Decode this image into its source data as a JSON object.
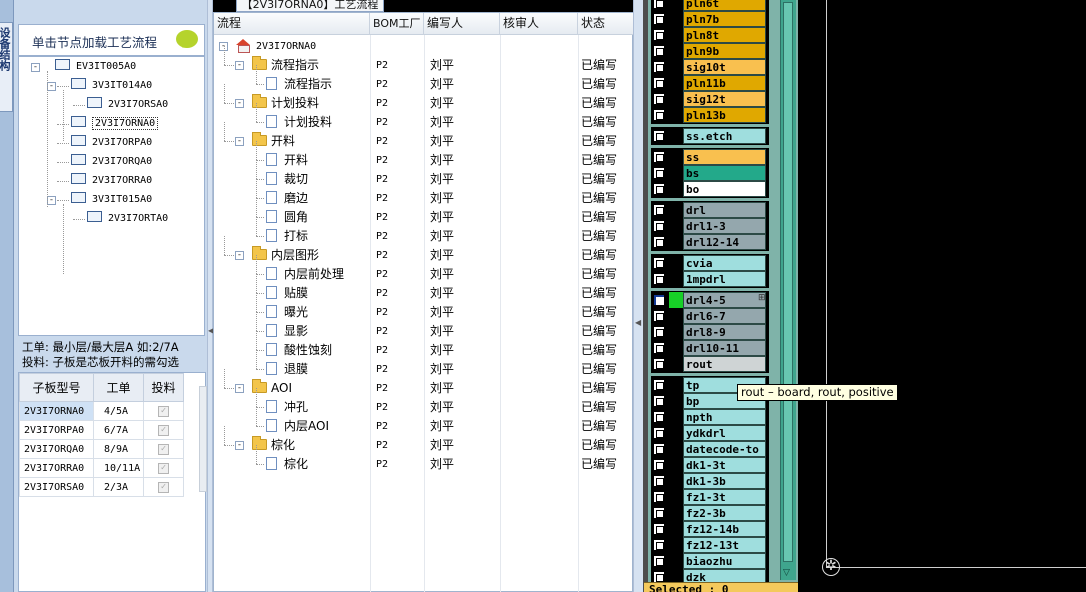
{
  "window_title_tab": "【2V3I7ORNA0】工艺流程",
  "left": {
    "side_tab": "设备结构",
    "hint": "单击节点加载工艺流程",
    "tree": [
      {
        "label": "EV3IT005A0",
        "level": 0,
        "expand": "-"
      },
      {
        "label": "3V3IT014A0",
        "level": 1,
        "expand": "-"
      },
      {
        "label": "2V3I7ORSA0",
        "level": 2
      },
      {
        "label": "2V3I7ORNA0",
        "level": 1,
        "selected": true
      },
      {
        "label": "2V3I7ORPA0",
        "level": 1
      },
      {
        "label": "2V3I7ORQA0",
        "level": 1
      },
      {
        "label": "2V3I7ORRA0",
        "level": 1
      },
      {
        "label": "3V3IT015A0",
        "level": 1,
        "expand": "-"
      },
      {
        "label": "2V3I7ORTA0",
        "level": 2
      }
    ],
    "info_line1": "工单: 最小层/最大层A 如:2/7A",
    "info_line2": "投料: 子板是芯板开料的需勾选",
    "grid_headers": [
      "子板型号",
      "工单",
      "投料"
    ],
    "grid_rows": [
      {
        "model": "2V3I7ORNA0",
        "order": "4/5A",
        "selected": true
      },
      {
        "model": "2V3I7ORPA0",
        "order": "6/7A"
      },
      {
        "model": "2V3I7ORQA0",
        "order": "8/9A"
      },
      {
        "model": "2V3I7ORRA0",
        "order": "10/11A"
      },
      {
        "model": "2V3I7ORSA0",
        "order": "2/3A"
      }
    ]
  },
  "main": {
    "headers": [
      "流程",
      "BOM工厂",
      "编写人",
      "核审人",
      "状态"
    ],
    "rows": [
      {
        "name": "2V3I7ORNA0",
        "type": "root",
        "level": 0,
        "bom": "",
        "writer": "",
        "status": ""
      },
      {
        "name": "流程指示",
        "type": "folder",
        "level": 1,
        "bom": "P2",
        "writer": "刘平",
        "status": "已编写"
      },
      {
        "name": "流程指示",
        "type": "doc",
        "level": 2,
        "bom": "P2",
        "writer": "刘平",
        "status": "已编写"
      },
      {
        "name": "计划投料",
        "type": "folder",
        "level": 1,
        "bom": "P2",
        "writer": "刘平",
        "status": "已编写"
      },
      {
        "name": "计划投料",
        "type": "doc",
        "level": 2,
        "bom": "P2",
        "writer": "刘平",
        "status": "已编写"
      },
      {
        "name": "开料",
        "type": "folder",
        "level": 1,
        "bom": "P2",
        "writer": "刘平",
        "status": "已编写"
      },
      {
        "name": "开料",
        "type": "doc",
        "level": 2,
        "bom": "P2",
        "writer": "刘平",
        "status": "已编写"
      },
      {
        "name": "裁切",
        "type": "doc",
        "level": 2,
        "bom": "P2",
        "writer": "刘平",
        "status": "已编写"
      },
      {
        "name": "磨边",
        "type": "doc",
        "level": 2,
        "bom": "P2",
        "writer": "刘平",
        "status": "已编写"
      },
      {
        "name": "圆角",
        "type": "doc",
        "level": 2,
        "bom": "P2",
        "writer": "刘平",
        "status": "已编写"
      },
      {
        "name": "打标",
        "type": "doc",
        "level": 2,
        "bom": "P2",
        "writer": "刘平",
        "status": "已编写"
      },
      {
        "name": "内层图形",
        "type": "folder",
        "level": 1,
        "bom": "P2",
        "writer": "刘平",
        "status": "已编写"
      },
      {
        "name": "内层前处理",
        "type": "doc",
        "level": 2,
        "bom": "P2",
        "writer": "刘平",
        "status": "已编写"
      },
      {
        "name": "贴膜",
        "type": "doc",
        "level": 2,
        "bom": "P2",
        "writer": "刘平",
        "status": "已编写"
      },
      {
        "name": "曝光",
        "type": "doc",
        "level": 2,
        "bom": "P2",
        "writer": "刘平",
        "status": "已编写"
      },
      {
        "name": "显影",
        "type": "doc",
        "level": 2,
        "bom": "P2",
        "writer": "刘平",
        "status": "已编写"
      },
      {
        "name": "酸性蚀刻",
        "type": "doc",
        "level": 2,
        "bom": "P2",
        "writer": "刘平",
        "status": "已编写"
      },
      {
        "name": "退膜",
        "type": "doc",
        "level": 2,
        "bom": "P2",
        "writer": "刘平",
        "status": "已编写"
      },
      {
        "name": "AOI",
        "type": "folder",
        "level": 1,
        "bom": "P2",
        "writer": "刘平",
        "status": "已编写"
      },
      {
        "name": "冲孔",
        "type": "doc",
        "level": 2,
        "bom": "P2",
        "writer": "刘平",
        "status": "已编写"
      },
      {
        "name": "内层AOI",
        "type": "doc",
        "level": 2,
        "bom": "P2",
        "writer": "刘平",
        "status": "已编写"
      },
      {
        "name": "棕化",
        "type": "folder",
        "level": 1,
        "bom": "P2",
        "writer": "刘平",
        "status": "已编写"
      },
      {
        "name": "棕化",
        "type": "doc",
        "level": 2,
        "bom": "P2",
        "writer": "刘平",
        "status": "已编写"
      }
    ]
  },
  "layers": {
    "colors": {
      "orange": "#e0a800",
      "light_orange": "#f9c04f",
      "teal": "#23a98a",
      "gray": "#94a7ad",
      "aqua": "#9fdede",
      "light_gray": "#cfd4d5",
      "white": "#ffffff"
    },
    "groups": [
      {
        "items": [
          {
            "name": "pln6t",
            "color": "#e0a800"
          },
          {
            "name": "pln7b",
            "color": "#e0a800"
          },
          {
            "name": "pln8t",
            "color": "#e0a800"
          },
          {
            "name": "pln9b",
            "color": "#e0a800"
          },
          {
            "name": "sig10t",
            "color": "#f9c04f"
          },
          {
            "name": "pln11b",
            "color": "#e0a800"
          },
          {
            "name": "sig12t",
            "color": "#f9c04f"
          },
          {
            "name": "pln13b",
            "color": "#e0a800"
          }
        ]
      },
      {
        "items": [
          {
            "name": "ss.etch",
            "color": "#9fdede"
          }
        ]
      },
      {
        "items": [
          {
            "name": "ss",
            "color": "#f9c04f"
          },
          {
            "name": "bs",
            "color": "#23a98a"
          },
          {
            "name": "bo",
            "color": "#ffffff"
          }
        ]
      },
      {
        "items": [
          {
            "name": "drl",
            "color": "#94a7ad"
          },
          {
            "name": "drl1-3",
            "color": "#94a7ad"
          },
          {
            "name": "drl12-14",
            "color": "#94a7ad"
          }
        ]
      },
      {
        "items": [
          {
            "name": "cvia",
            "color": "#9fdede"
          },
          {
            "name": "1mpdrl",
            "color": "#9fdede"
          }
        ]
      },
      {
        "items": [
          {
            "name": "drl4-5",
            "color": "#94a7ad",
            "active": true
          },
          {
            "name": "drl6-7",
            "color": "#94a7ad"
          },
          {
            "name": "drl8-9",
            "color": "#94a7ad"
          },
          {
            "name": "drl10-11",
            "color": "#94a7ad"
          },
          {
            "name": "rout",
            "color": "#cfd4d5"
          }
        ]
      },
      {
        "items": [
          {
            "name": "tp",
            "color": "#9fdede"
          },
          {
            "name": "bp",
            "color": "#9fdede"
          },
          {
            "name": "npth",
            "color": "#9fdede"
          },
          {
            "name": "ydkdrl",
            "color": "#9fdede"
          },
          {
            "name": "datecode-to",
            "color": "#9fdede"
          },
          {
            "name": "dk1-3t",
            "color": "#9fdede"
          },
          {
            "name": "dk1-3b",
            "color": "#9fdede"
          },
          {
            "name": "fz1-3t",
            "color": "#9fdede"
          },
          {
            "name": "fz2-3b",
            "color": "#9fdede"
          },
          {
            "name": "fz12-14b",
            "color": "#9fdede"
          },
          {
            "name": "fz12-13t",
            "color": "#9fdede"
          },
          {
            "name": "biaozhu",
            "color": "#9fdede"
          },
          {
            "name": "dzk",
            "color": "#9fdede"
          }
        ]
      }
    ],
    "selected_label": "Selected : 0"
  },
  "tooltip": "rout – board, rout, positive"
}
